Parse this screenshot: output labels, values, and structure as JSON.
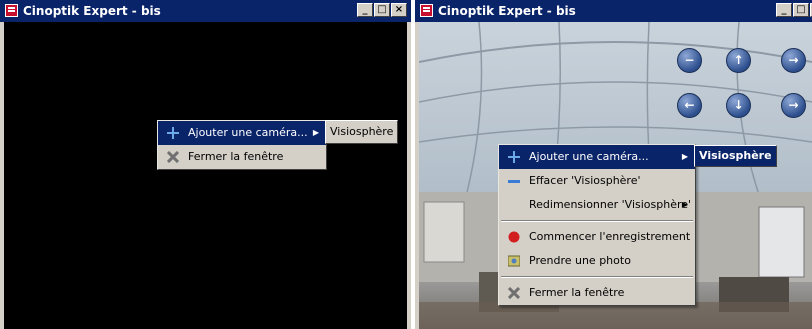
{
  "left_window": {
    "title": "Cinoptik Expert - bis",
    "buttons": {
      "minimize": "_",
      "maximize": "□",
      "close": "×"
    },
    "context_menu": {
      "items": [
        {
          "label": "Ajouter une caméra...",
          "icon": "plus-icon",
          "submenu": true
        },
        {
          "label": "Fermer la fenêtre",
          "icon": "close-x-icon"
        }
      ],
      "submenu_item": "Visiosphère"
    }
  },
  "right_window": {
    "title": "Cinoptik Expert - bis",
    "buttons": {
      "minimize": "_",
      "maximize": "□",
      "close": "×"
    },
    "nav_buttons": [
      "zoom-out",
      "up",
      "right",
      "left",
      "down",
      "right"
    ],
    "context_menu": {
      "items": [
        {
          "label": "Ajouter une caméra...",
          "icon": "plus-icon",
          "submenu": true
        },
        {
          "label": "Effacer 'Visiosphère'",
          "icon": "minus-icon"
        },
        {
          "label": "Redimensionner 'Visiosphère'",
          "icon": "",
          "submenu": true
        },
        {
          "label": "Commencer l'enregistrement",
          "icon": "record-icon"
        },
        {
          "label": "Prendre une photo",
          "icon": "camera-photo-icon"
        },
        {
          "label": "Fermer la fenêtre",
          "icon": "close-x-icon"
        }
      ],
      "submenu_item": "Visiosphère"
    }
  },
  "colors": {
    "titlebar": "#0a246a",
    "menu_bg": "#d4d0c8",
    "selection": "#0a246a"
  }
}
